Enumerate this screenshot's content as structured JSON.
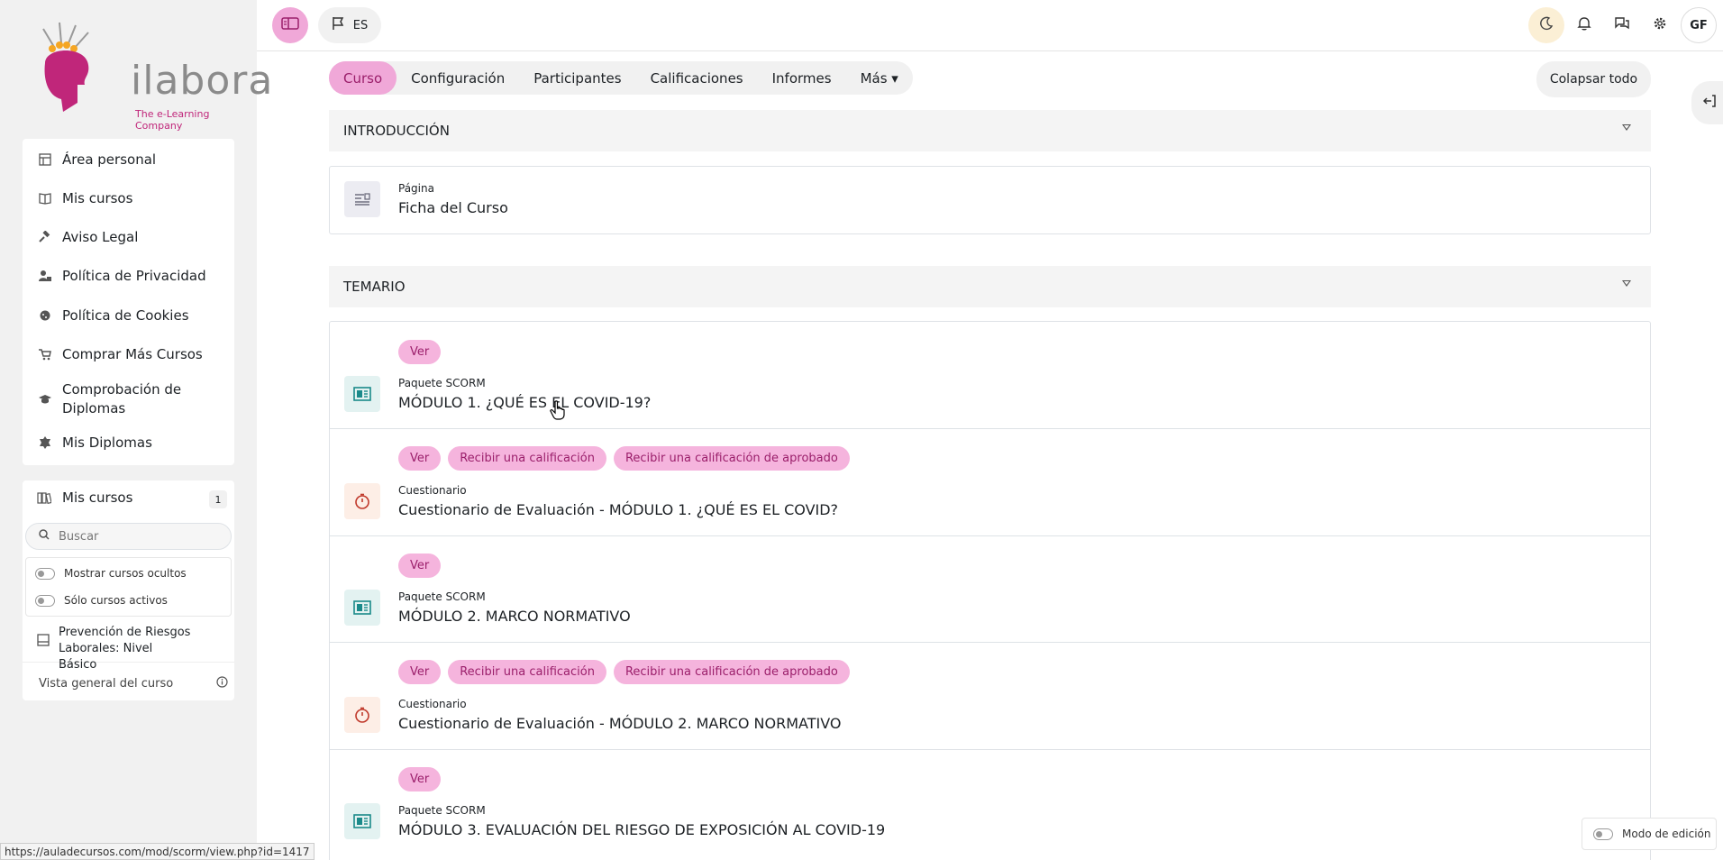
{
  "logo": {
    "word": "ilabora",
    "tagline": "The e-Learning Company"
  },
  "nav": [
    {
      "label": "Área personal",
      "icon": "dashboard-icon"
    },
    {
      "label": "Mis cursos",
      "icon": "book-icon"
    },
    {
      "label": "Aviso Legal",
      "icon": "gavel-icon"
    },
    {
      "label": "Política de Privacidad",
      "icon": "user-lock-icon"
    },
    {
      "label": "Política de Cookies",
      "icon": "cookie-icon"
    },
    {
      "label": "Comprar Más Cursos",
      "icon": "cart-icon"
    },
    {
      "label": "Comprobación de Diplomas",
      "icon": "graduation-cap-icon"
    },
    {
      "label": "Mis Diplomas",
      "icon": "certificate-icon"
    }
  ],
  "mycourses": {
    "title": "Mis cursos",
    "count": "1",
    "search_placeholder": "Buscar",
    "filters": [
      "Mostrar cursos ocultos",
      "Sólo cursos activos"
    ],
    "course": "Prevención de Riesgos Laborales: Nivel Básico",
    "overview": "Vista general del curso"
  },
  "topbar": {
    "lang": "ES",
    "avatar": "GF"
  },
  "tabs": [
    {
      "label": "Curso",
      "active": true
    },
    {
      "label": "Configuración",
      "active": false
    },
    {
      "label": "Participantes",
      "active": false
    },
    {
      "label": "Calificaciones",
      "active": false
    },
    {
      "label": "Informes",
      "active": false
    },
    {
      "label": "Más ▾",
      "active": false
    }
  ],
  "collapse_all": "Colapsar todo",
  "sections": [
    {
      "title": "INTRODUCCIÓN"
    },
    {
      "title": "TEMARIO"
    }
  ],
  "intro_activity": {
    "type": "Página",
    "name": "Ficha del Curso"
  },
  "activities": [
    {
      "badges": [
        "Ver"
      ],
      "type": "Paquete SCORM",
      "name": "MÓDULO 1. ¿QUÉ ES EL COVID-19?",
      "kind": "scorm"
    },
    {
      "badges": [
        "Ver",
        "Recibir una calificación",
        "Recibir una calificación de aprobado"
      ],
      "type": "Cuestionario",
      "name": "Cuestionario de Evaluación - MÓDULO 1. ¿QUÉ ES EL COVID?",
      "kind": "quiz"
    },
    {
      "badges": [
        "Ver"
      ],
      "type": "Paquete SCORM",
      "name": "MÓDULO 2. MARCO NORMATIVO",
      "kind": "scorm"
    },
    {
      "badges": [
        "Ver",
        "Recibir una calificación",
        "Recibir una calificación de aprobado"
      ],
      "type": "Cuestionario",
      "name": "Cuestionario de Evaluación - MÓDULO 2. MARCO NORMATIVO",
      "kind": "quiz"
    },
    {
      "badges": [
        "Ver"
      ],
      "type": "Paquete SCORM",
      "name": "MÓDULO 3. EVALUACIÓN DEL RIESGO DE EXPOSICIÓN AL COVID-19",
      "kind": "scorm"
    }
  ],
  "status_url": "https://auladecursos.com/mod/scorm/view.php?id=1417",
  "edit_mode": "Modo de edición",
  "colors": {
    "accent": "#f0a8d8",
    "accent_text": "#9b1f6b",
    "scorm": "#1a8a8a",
    "quiz": "#c0392b"
  }
}
